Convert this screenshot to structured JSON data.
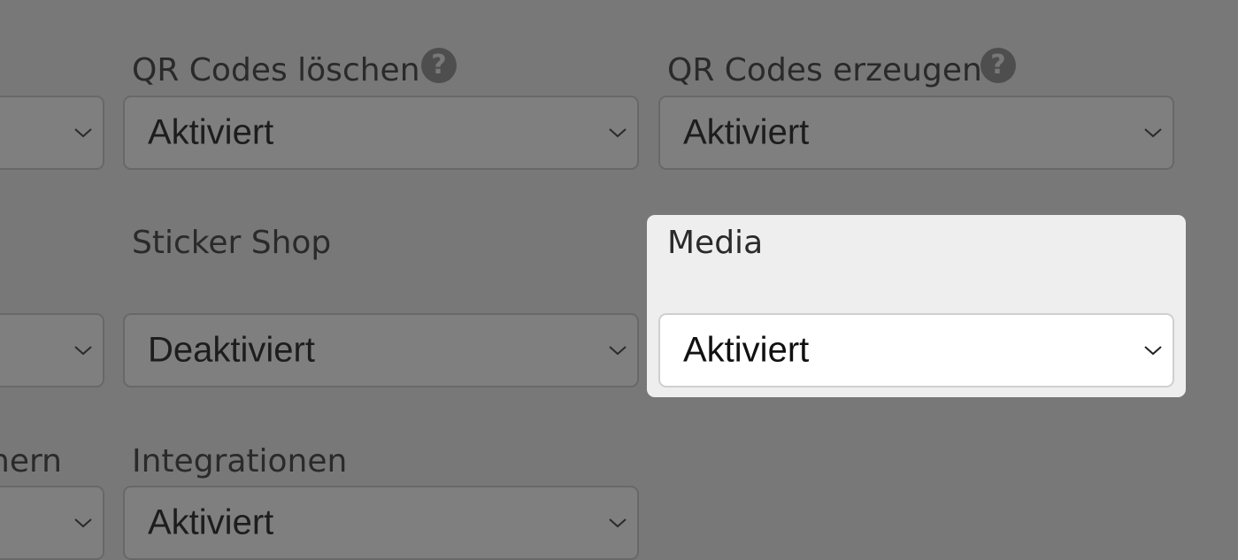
{
  "row1": {
    "col2": {
      "label": "QR Codes löschen",
      "help_icon": "question-circle-icon",
      "value": "Aktiviert"
    },
    "col3": {
      "label": "QR Codes erzeugen",
      "help_icon": "question-circle-icon",
      "value": "Aktiviert"
    }
  },
  "row2": {
    "col2": {
      "label": "Sticker Shop",
      "value": "Deaktiviert"
    },
    "col3": {
      "label": "Media",
      "value": "Aktiviert"
    }
  },
  "row3": {
    "col1": {
      "label_partial": "nern"
    },
    "col2": {
      "label": "Integrationen",
      "value": "Aktiviert"
    }
  },
  "colors": {
    "overlay": "#787878",
    "highlight_background": "#eeeeee",
    "highlight_select": "#ffffff"
  }
}
